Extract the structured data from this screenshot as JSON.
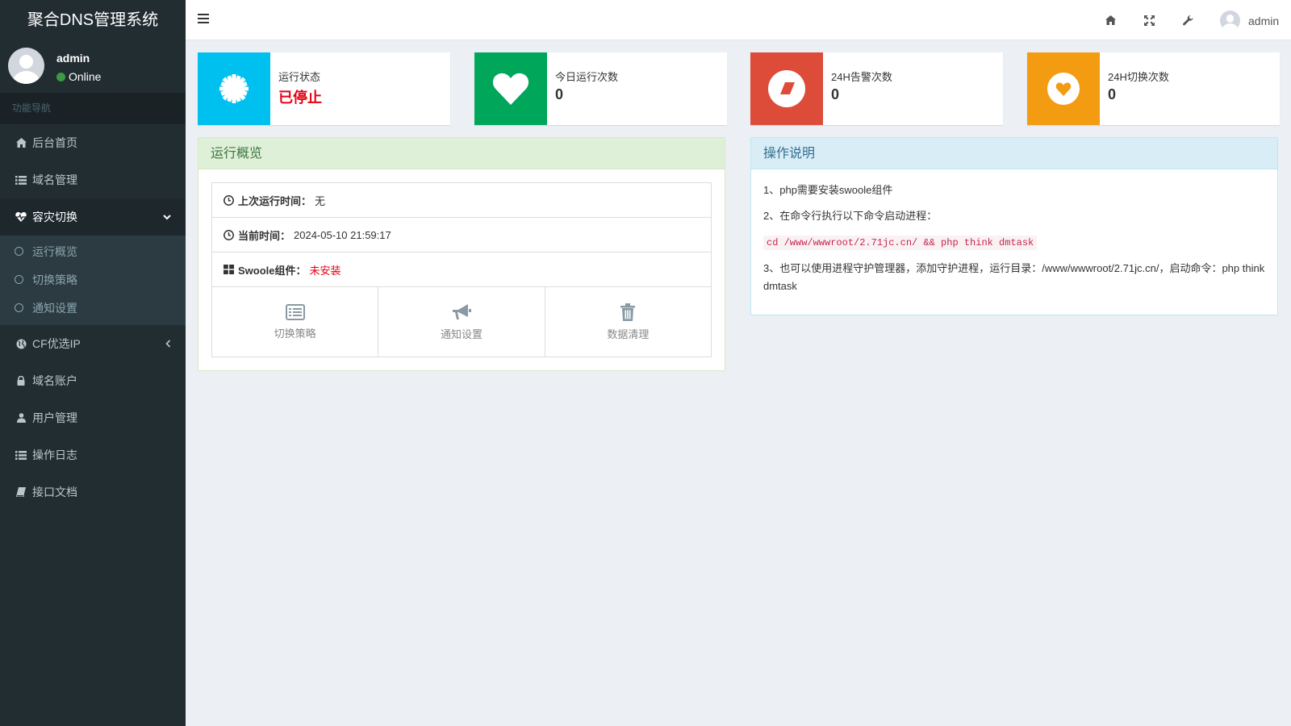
{
  "app": {
    "title": "聚合DNS管理系统"
  },
  "user": {
    "name": "admin",
    "status": "Online"
  },
  "sidebar": {
    "header": "功能导航",
    "items": [
      {
        "label": "后台首页",
        "icon": "home-icon"
      },
      {
        "label": "域名管理",
        "icon": "list-icon"
      },
      {
        "label": "容灾切换",
        "icon": "heartbeat-icon",
        "expanded": true,
        "children": [
          {
            "label": "运行概览"
          },
          {
            "label": "切换策略"
          },
          {
            "label": "通知设置"
          }
        ]
      },
      {
        "label": "CF优选IP",
        "icon": "globe-icon"
      },
      {
        "label": "域名账户",
        "icon": "lock-icon"
      },
      {
        "label": "用户管理",
        "icon": "user-icon"
      },
      {
        "label": "操作日志",
        "icon": "list-icon"
      },
      {
        "label": "接口文档",
        "icon": "book-icon"
      }
    ]
  },
  "header": {
    "icons": [
      "home-icon",
      "fullscreen-icon",
      "wrench-icon"
    ],
    "user_name": "admin"
  },
  "info_boxes": [
    {
      "label": "运行状态",
      "value": "已停止",
      "color": "#00c0ef",
      "icon": "cog-icon"
    },
    {
      "label": "今日运行次数",
      "value": "0",
      "color": "#00a65a",
      "icon": "heart-icon"
    },
    {
      "label": "24H告警次数",
      "value": "0",
      "color": "#dd4b39",
      "icon": "eraser-icon"
    },
    {
      "label": "24H切换次数",
      "value": "0",
      "color": "#f39c12",
      "icon": "heart-circle-icon"
    }
  ],
  "overview": {
    "title": "运行概览",
    "rows": [
      {
        "key": "上次运行时间：",
        "value": "无"
      },
      {
        "key": "当前时间：",
        "value": "2024-05-10 21:59:17"
      },
      {
        "key": "Swoole组件：",
        "value": "未安装"
      }
    ],
    "buttons": [
      {
        "label": "切换策略",
        "icon": "list-alt-icon"
      },
      {
        "label": "通知设置",
        "icon": "bullhorn-icon"
      },
      {
        "label": "数据清理",
        "icon": "trash-icon"
      }
    ]
  },
  "instructions": {
    "title": "操作说明",
    "line1": "1、php需要安装swoole组件",
    "line2": "2、在命令行执行以下命令启动进程：",
    "command": "cd /www/wwwroot/2.71jc.cn/ && php think dmtask",
    "line3": "3、也可以使用进程守护管理器，添加守护进程，运行目录：/www/wwwroot/2.71jc.cn/，启动命令：php think dmtask"
  }
}
